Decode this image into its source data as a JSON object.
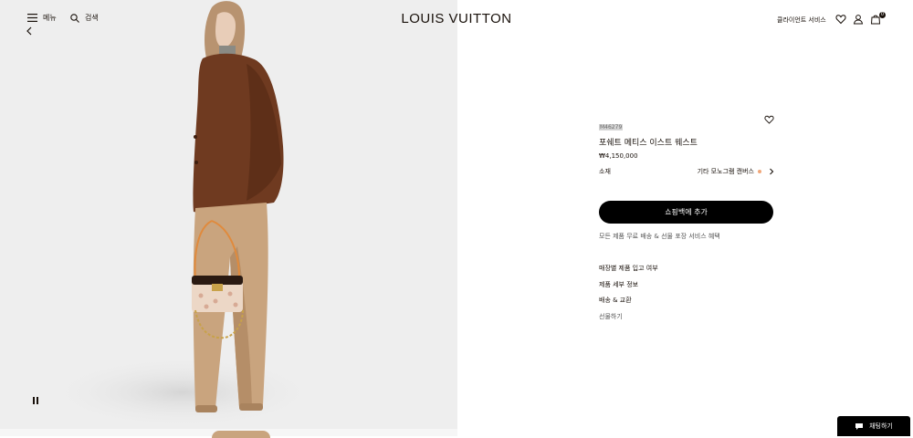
{
  "header": {
    "menu_label": "메뉴",
    "search_label": "검색",
    "logo": "LOUIS VUITTON",
    "client_services": "클라이언트 서비스",
    "cart_count": "0",
    "icons": [
      "menu-icon",
      "search-icon",
      "back-arrow-icon",
      "heart-icon",
      "user-icon",
      "shopping-bag-icon"
    ]
  },
  "hero": {
    "image": "photo of model in brown jacket and beige trousers holding monogram handbag",
    "pause_icon": "pause-icon"
  },
  "product": {
    "sku": "M46279",
    "name": "포쉐트 메티스 이스트 웨스트",
    "price": "₩4,150,000",
    "material_label": "소재",
    "material_value": "기타 모노그램 캔버스",
    "material_swatch_color": "#f0a77a",
    "add_to_cart": "쇼핑백에 추가",
    "shipping_note": "모든 제품 무료 배송 & 선물 포장 서비스 혜택",
    "links": [
      {
        "label": "매장별 제품 입고 여부"
      },
      {
        "label": "제품 세부 정보"
      },
      {
        "label": "배송 & 교환"
      },
      {
        "label": "선물하기"
      }
    ]
  },
  "chat": {
    "label": "채팅하기"
  },
  "colors": {
    "brand_black": "#19110b",
    "button_black": "#000000",
    "hero_bg": "#eeeeee"
  }
}
